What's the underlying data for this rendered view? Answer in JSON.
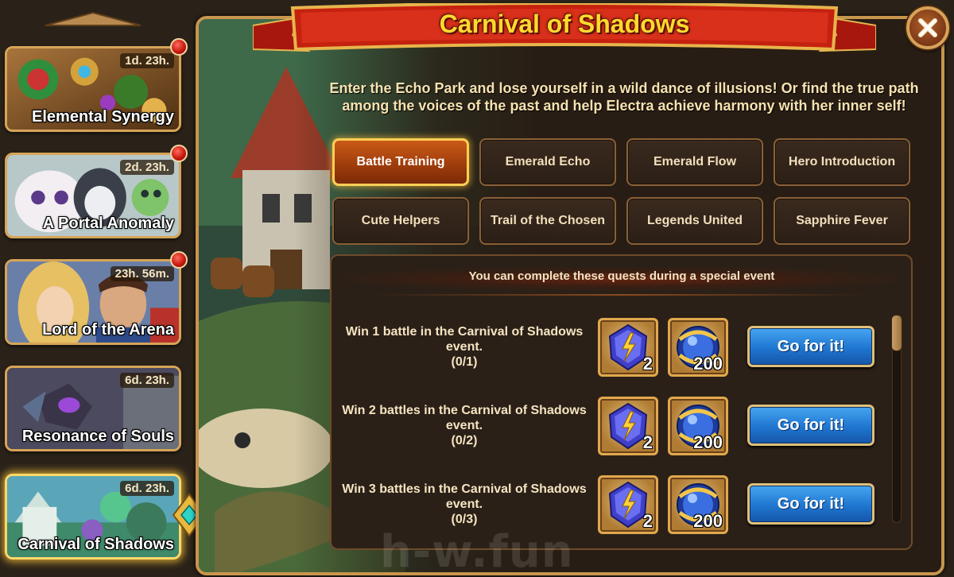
{
  "events": [
    {
      "title": "Elemental Synergy",
      "timer": "1d. 23h.",
      "notification": true,
      "active": false
    },
    {
      "title": "A Portal Anomaly",
      "timer": "2d. 23h.",
      "notification": true,
      "active": false
    },
    {
      "title": "Lord of the Arena",
      "timer": "23h. 56m.",
      "notification": true,
      "active": false
    },
    {
      "title": "Resonance of Souls",
      "timer": "6d. 23h.",
      "notification": false,
      "active": false
    },
    {
      "title": "Carnival of Shadows",
      "timer": "6d. 23h.",
      "notification": false,
      "active": true
    }
  ],
  "panel": {
    "title": "Carnival of Shadows",
    "description": "Enter the Echo Park and lose yourself in a wild dance of illusions! Or find the true path among the voices of the past and help Electra achieve harmony with her inner self!"
  },
  "tabs": [
    {
      "label": "Battle Training",
      "active": true
    },
    {
      "label": "Emerald Echo",
      "active": false
    },
    {
      "label": "Emerald Flow",
      "active": false
    },
    {
      "label": "Hero Introduction",
      "active": false
    },
    {
      "label": "Cute Helpers",
      "active": false
    },
    {
      "label": "Trail of the Chosen",
      "active": false
    },
    {
      "label": "Legends United",
      "active": false
    },
    {
      "label": "Sapphire Fever",
      "active": false
    }
  ],
  "quests": {
    "header": "You can complete these quests during a special event",
    "items": [
      {
        "line1": "Win 1 battle in the Carnival of Shadows",
        "line2": "event.",
        "progress": "(0/1)",
        "reward1_count": "2",
        "reward2_count": "200",
        "button": "Go for it!"
      },
      {
        "line1": "Win 2 battles in the Carnival of Shadows",
        "line2": "event.",
        "progress": "(0/2)",
        "reward1_count": "2",
        "reward2_count": "200",
        "button": "Go for it!"
      },
      {
        "line1": "Win 3 battles in the Carnival of Shadows",
        "line2": "event.",
        "progress": "(0/3)",
        "reward1_count": "2",
        "reward2_count": "200",
        "button": "Go for it!"
      }
    ]
  },
  "icons": {
    "reward1": "lightning-crystal-icon",
    "reward2": "blue-orb-icon",
    "close": "close-icon"
  },
  "watermark": "h-w.fun",
  "colors": {
    "title_gold": "#ffd92e",
    "active_tab": "#ca5a17",
    "go_button": "#1f76d0",
    "frame": "#c9954d"
  }
}
